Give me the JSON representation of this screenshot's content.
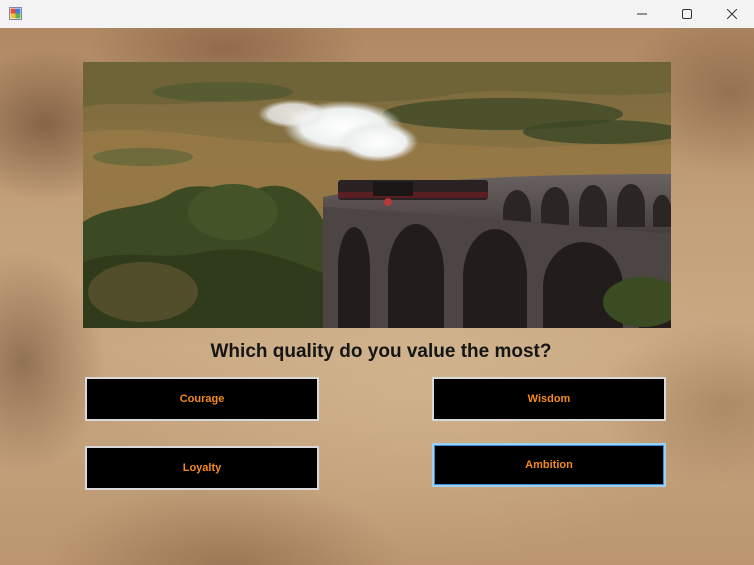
{
  "window": {
    "controls": {
      "minimize": "─",
      "maximize": "□",
      "close": "✕"
    }
  },
  "quiz": {
    "question": "Which quality do you value the most?",
    "answers": [
      "Courage",
      "Wisdom",
      "Loyalty",
      "Ambition"
    ],
    "focused_answer": "Ambition"
  },
  "colors": {
    "button_bg": "#000000",
    "button_text": "#f5891e",
    "button_border": "#d9d9d9",
    "focus_border": "#9fd0f2"
  },
  "icons": [
    "app-icon",
    "minimize-icon",
    "maximize-icon",
    "close-icon"
  ]
}
